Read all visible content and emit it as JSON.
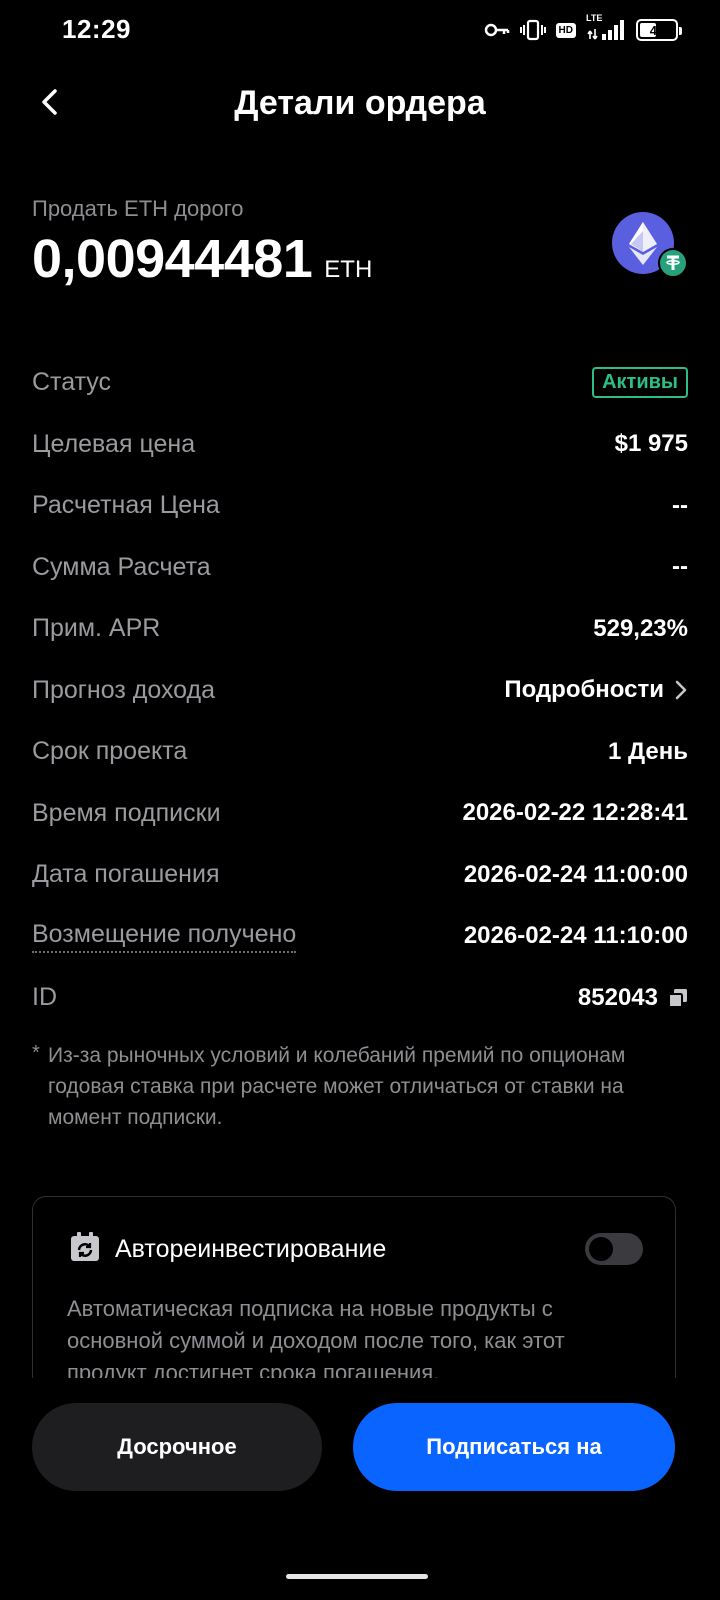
{
  "status_bar": {
    "time": "12:29",
    "network_badge": "HD",
    "network_type": "LTE",
    "battery_level": "46",
    "battery_fraction": 0.46
  },
  "header": {
    "title": "Детали ордера",
    "back_icon": "chevron-left-icon"
  },
  "order": {
    "label": "Продать ETH дорого",
    "amount": "0,00944481",
    "unit": "ETH",
    "coin_icons": [
      "eth-icon",
      "usdt-icon"
    ]
  },
  "details": {
    "status_label": "Статус",
    "status_value": "Активы",
    "target_price_label": "Целевая цена",
    "target_price_value": "$1 975",
    "settlement_price_label": "Расчетная Цена",
    "settlement_price_value": "--",
    "settlement_amount_label": "Сумма Расчета",
    "settlement_amount_value": "--",
    "apr_label": "Прим. APR",
    "apr_value": "529,23%",
    "income_forecast_label": "Прогноз дохода",
    "income_forecast_value": "Подробности",
    "term_label": "Срок проекта",
    "term_value": "1 День",
    "subscription_time_label": "Время подписки",
    "subscription_time_value": "2026-02-22 12:28:41",
    "maturity_date_label": "Дата погашения",
    "maturity_date_value": "2026-02-24 11:00:00",
    "refund_received_label": "Возмещение получено",
    "refund_received_value": "2026-02-24 11:10:00",
    "id_label": "ID",
    "id_value": "852043"
  },
  "note": {
    "star": "*",
    "text": "Из-за рыночных условий и колебаний премий по опционам годовая ставка при расчете может отличаться от ставки на момент подписки."
  },
  "reinvest": {
    "title": "Автореинвестирование",
    "enabled": false,
    "description": "Автоматическая подписка на новые продукты с основной суммой и доходом после того, как этот продукт достигнет срока погашения."
  },
  "actions": {
    "early_label": "Досрочное",
    "subscribe_label": "Подписаться на"
  },
  "colors": {
    "accent": "#0a64ff",
    "active_green": "#2ebd85",
    "eth": "#5a5fe0",
    "usdt": "#26a17b"
  }
}
